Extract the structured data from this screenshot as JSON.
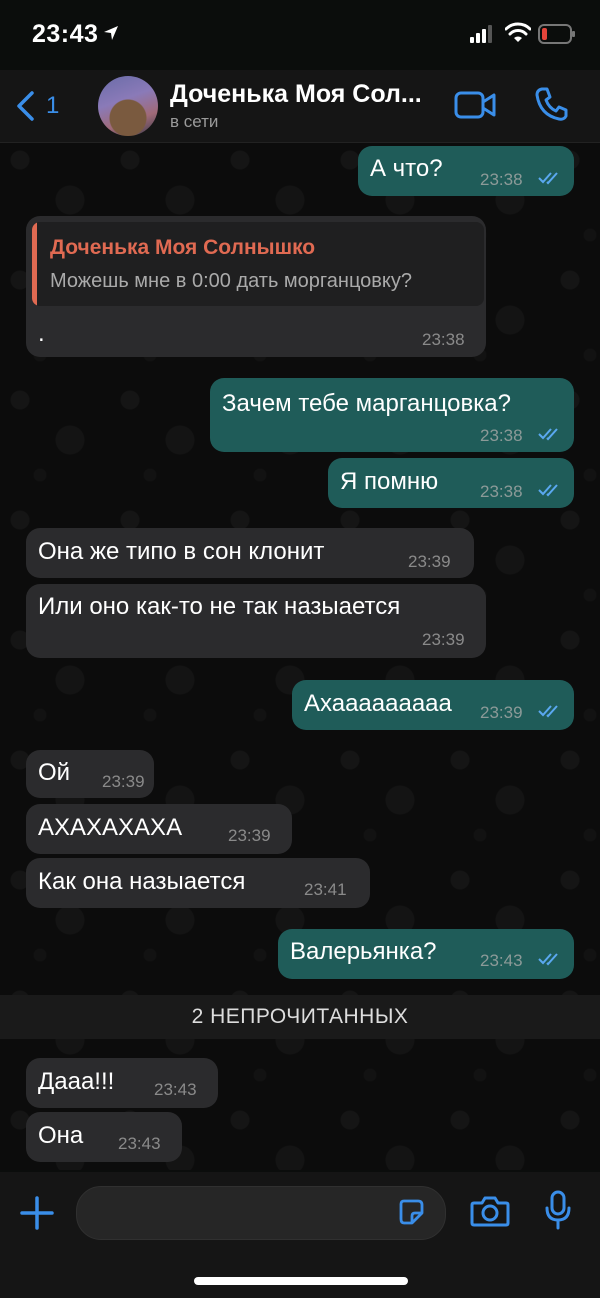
{
  "status_bar": {
    "time": "23:43"
  },
  "header": {
    "back_count": "1",
    "title": "Доченька Моя Сол...",
    "subtitle": "в сети"
  },
  "messages": [
    {
      "dir": "out",
      "text": "А что?",
      "time": "23:38"
    },
    {
      "dir": "in",
      "reply_name": "Доченька Моя Солнышко",
      "reply_text": "Можешь мне в 0:00 дать морганцовку?",
      "text": ".",
      "time": "23:38"
    },
    {
      "dir": "out",
      "text": "Зачем тебе марганцовка?",
      "time": "23:38"
    },
    {
      "dir": "out",
      "text": "Я помню",
      "time": "23:38"
    },
    {
      "dir": "in",
      "text": "Она же типо в сон клонит",
      "time": "23:39"
    },
    {
      "dir": "in",
      "text": "Или оно как-то не так назыается",
      "time": "23:39"
    },
    {
      "dir": "out",
      "text": "Ахааааааааа",
      "time": "23:39"
    },
    {
      "dir": "in",
      "text": "Ой",
      "time": "23:39"
    },
    {
      "dir": "in",
      "text": "АХАХАХАХА",
      "time": "23:39"
    },
    {
      "dir": "in",
      "text": "Как она назыается",
      "time": "23:41"
    },
    {
      "dir": "out",
      "text": "Валерьянка?",
      "time": "23:43"
    },
    {
      "dir": "in",
      "text": "Дааа!!!",
      "time": "23:43"
    },
    {
      "dir": "in",
      "text": "Она",
      "time": "23:43"
    }
  ],
  "unread_divider": "2 НЕПРОЧИТАННЫХ",
  "input": {
    "placeholder": ""
  },
  "colors": {
    "accent": "#3a8ee9",
    "outgoing": "#1f5c59",
    "incoming": "#2b2b2d",
    "reply_name": "#e06a52",
    "read_ticks": "#5aa8f0"
  }
}
